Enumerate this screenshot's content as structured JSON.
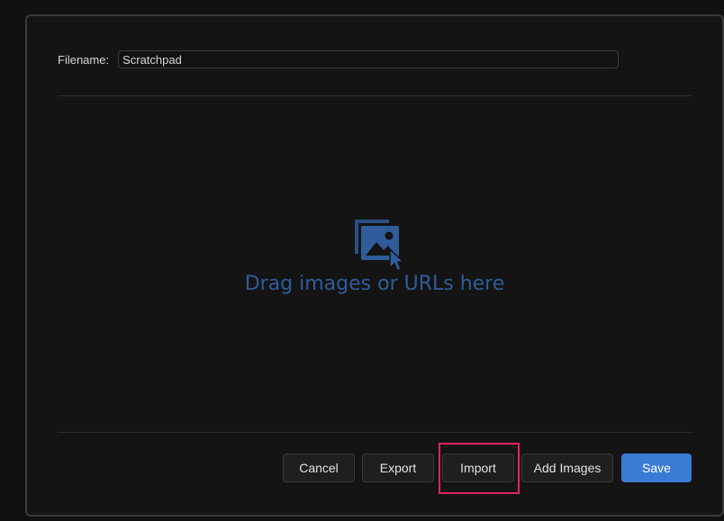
{
  "filename": {
    "label": "Filename:",
    "value": "Scratchpad"
  },
  "dropzone": {
    "icon": "image-drop-icon",
    "text": "Drag images or URLs here"
  },
  "buttons": {
    "cancel": "Cancel",
    "export": "Export",
    "import": "Import",
    "add_images": "Add Images",
    "save": "Save"
  },
  "colors": {
    "accent": "#3a7bd5",
    "drop_text": "#2f5c9a",
    "highlight": "#e0245e"
  }
}
